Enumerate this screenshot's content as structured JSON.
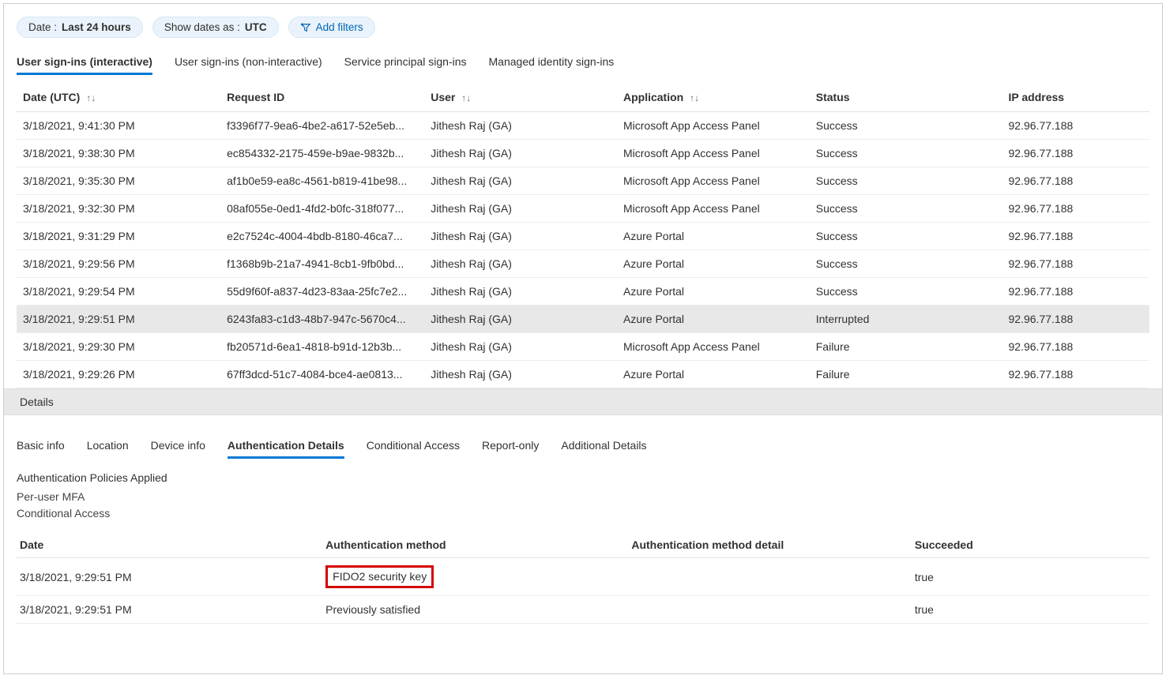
{
  "filters": {
    "date_label": "Date : ",
    "date_value": "Last 24 hours",
    "showas_label": "Show dates as : ",
    "showas_value": "UTC",
    "add_filters": "Add filters"
  },
  "tabs": {
    "interactive": "User sign-ins (interactive)",
    "noninteractive": "User sign-ins (non-interactive)",
    "sp": "Service principal sign-ins",
    "mi": "Managed identity sign-ins"
  },
  "columns": {
    "date": "Date (UTC)",
    "request_id": "Request ID",
    "user": "User",
    "application": "Application",
    "status": "Status",
    "ip": "IP address"
  },
  "rows": [
    {
      "date": "3/18/2021, 9:41:30 PM",
      "req": "f3396f77-9ea6-4be2-a617-52e5eb...",
      "user": "Jithesh Raj (GA)",
      "app": "Microsoft App Access Panel",
      "status": "Success",
      "ip": "92.96.77.188"
    },
    {
      "date": "3/18/2021, 9:38:30 PM",
      "req": "ec854332-2175-459e-b9ae-9832b...",
      "user": "Jithesh Raj (GA)",
      "app": "Microsoft App Access Panel",
      "status": "Success",
      "ip": "92.96.77.188"
    },
    {
      "date": "3/18/2021, 9:35:30 PM",
      "req": "af1b0e59-ea8c-4561-b819-41be98...",
      "user": "Jithesh Raj (GA)",
      "app": "Microsoft App Access Panel",
      "status": "Success",
      "ip": "92.96.77.188"
    },
    {
      "date": "3/18/2021, 9:32:30 PM",
      "req": "08af055e-0ed1-4fd2-b0fc-318f077...",
      "user": "Jithesh Raj (GA)",
      "app": "Microsoft App Access Panel",
      "status": "Success",
      "ip": "92.96.77.188"
    },
    {
      "date": "3/18/2021, 9:31:29 PM",
      "req": "e2c7524c-4004-4bdb-8180-46ca7...",
      "user": "Jithesh Raj (GA)",
      "app": "Azure Portal",
      "status": "Success",
      "ip": "92.96.77.188"
    },
    {
      "date": "3/18/2021, 9:29:56 PM",
      "req": "f1368b9b-21a7-4941-8cb1-9fb0bd...",
      "user": "Jithesh Raj (GA)",
      "app": "Azure Portal",
      "status": "Success",
      "ip": "92.96.77.188"
    },
    {
      "date": "3/18/2021, 9:29:54 PM",
      "req": "55d9f60f-a837-4d23-83aa-25fc7e2...",
      "user": "Jithesh Raj (GA)",
      "app": "Azure Portal",
      "status": "Success",
      "ip": "92.96.77.188"
    },
    {
      "date": "3/18/2021, 9:29:51 PM",
      "req": "6243fa83-c1d3-48b7-947c-5670c4...",
      "user": "Jithesh Raj (GA)",
      "app": "Azure Portal",
      "status": "Interrupted",
      "ip": "92.96.77.188"
    },
    {
      "date": "3/18/2021, 9:29:30 PM",
      "req": "fb20571d-6ea1-4818-b91d-12b3b...",
      "user": "Jithesh Raj (GA)",
      "app": "Microsoft App Access Panel",
      "status": "Failure",
      "ip": "92.96.77.188"
    },
    {
      "date": "3/18/2021, 9:29:26 PM",
      "req": "67ff3dcd-51c7-4084-bce4-ae0813...",
      "user": "Jithesh Raj (GA)",
      "app": "Azure Portal",
      "status": "Failure",
      "ip": "92.96.77.188"
    }
  ],
  "selected_row": 7,
  "details_label": "Details",
  "detail_tabs": {
    "basic": "Basic info",
    "location": "Location",
    "device": "Device info",
    "auth": "Authentication Details",
    "ca": "Conditional Access",
    "report": "Report-only",
    "additional": "Additional Details"
  },
  "policies": {
    "label": "Authentication Policies Applied",
    "line1": "Per-user MFA",
    "line2": "Conditional Access"
  },
  "auth_columns": {
    "date": "Date",
    "method": "Authentication method",
    "detail": "Authentication method detail",
    "succeeded": "Succeeded"
  },
  "auth_rows": [
    {
      "date": "3/18/2021, 9:29:51 PM",
      "method": "FIDO2 security key",
      "detail": "",
      "succeeded": "true",
      "highlight": true
    },
    {
      "date": "3/18/2021, 9:29:51 PM",
      "method": "Previously satisfied",
      "detail": "",
      "succeeded": "true",
      "highlight": false
    }
  ]
}
